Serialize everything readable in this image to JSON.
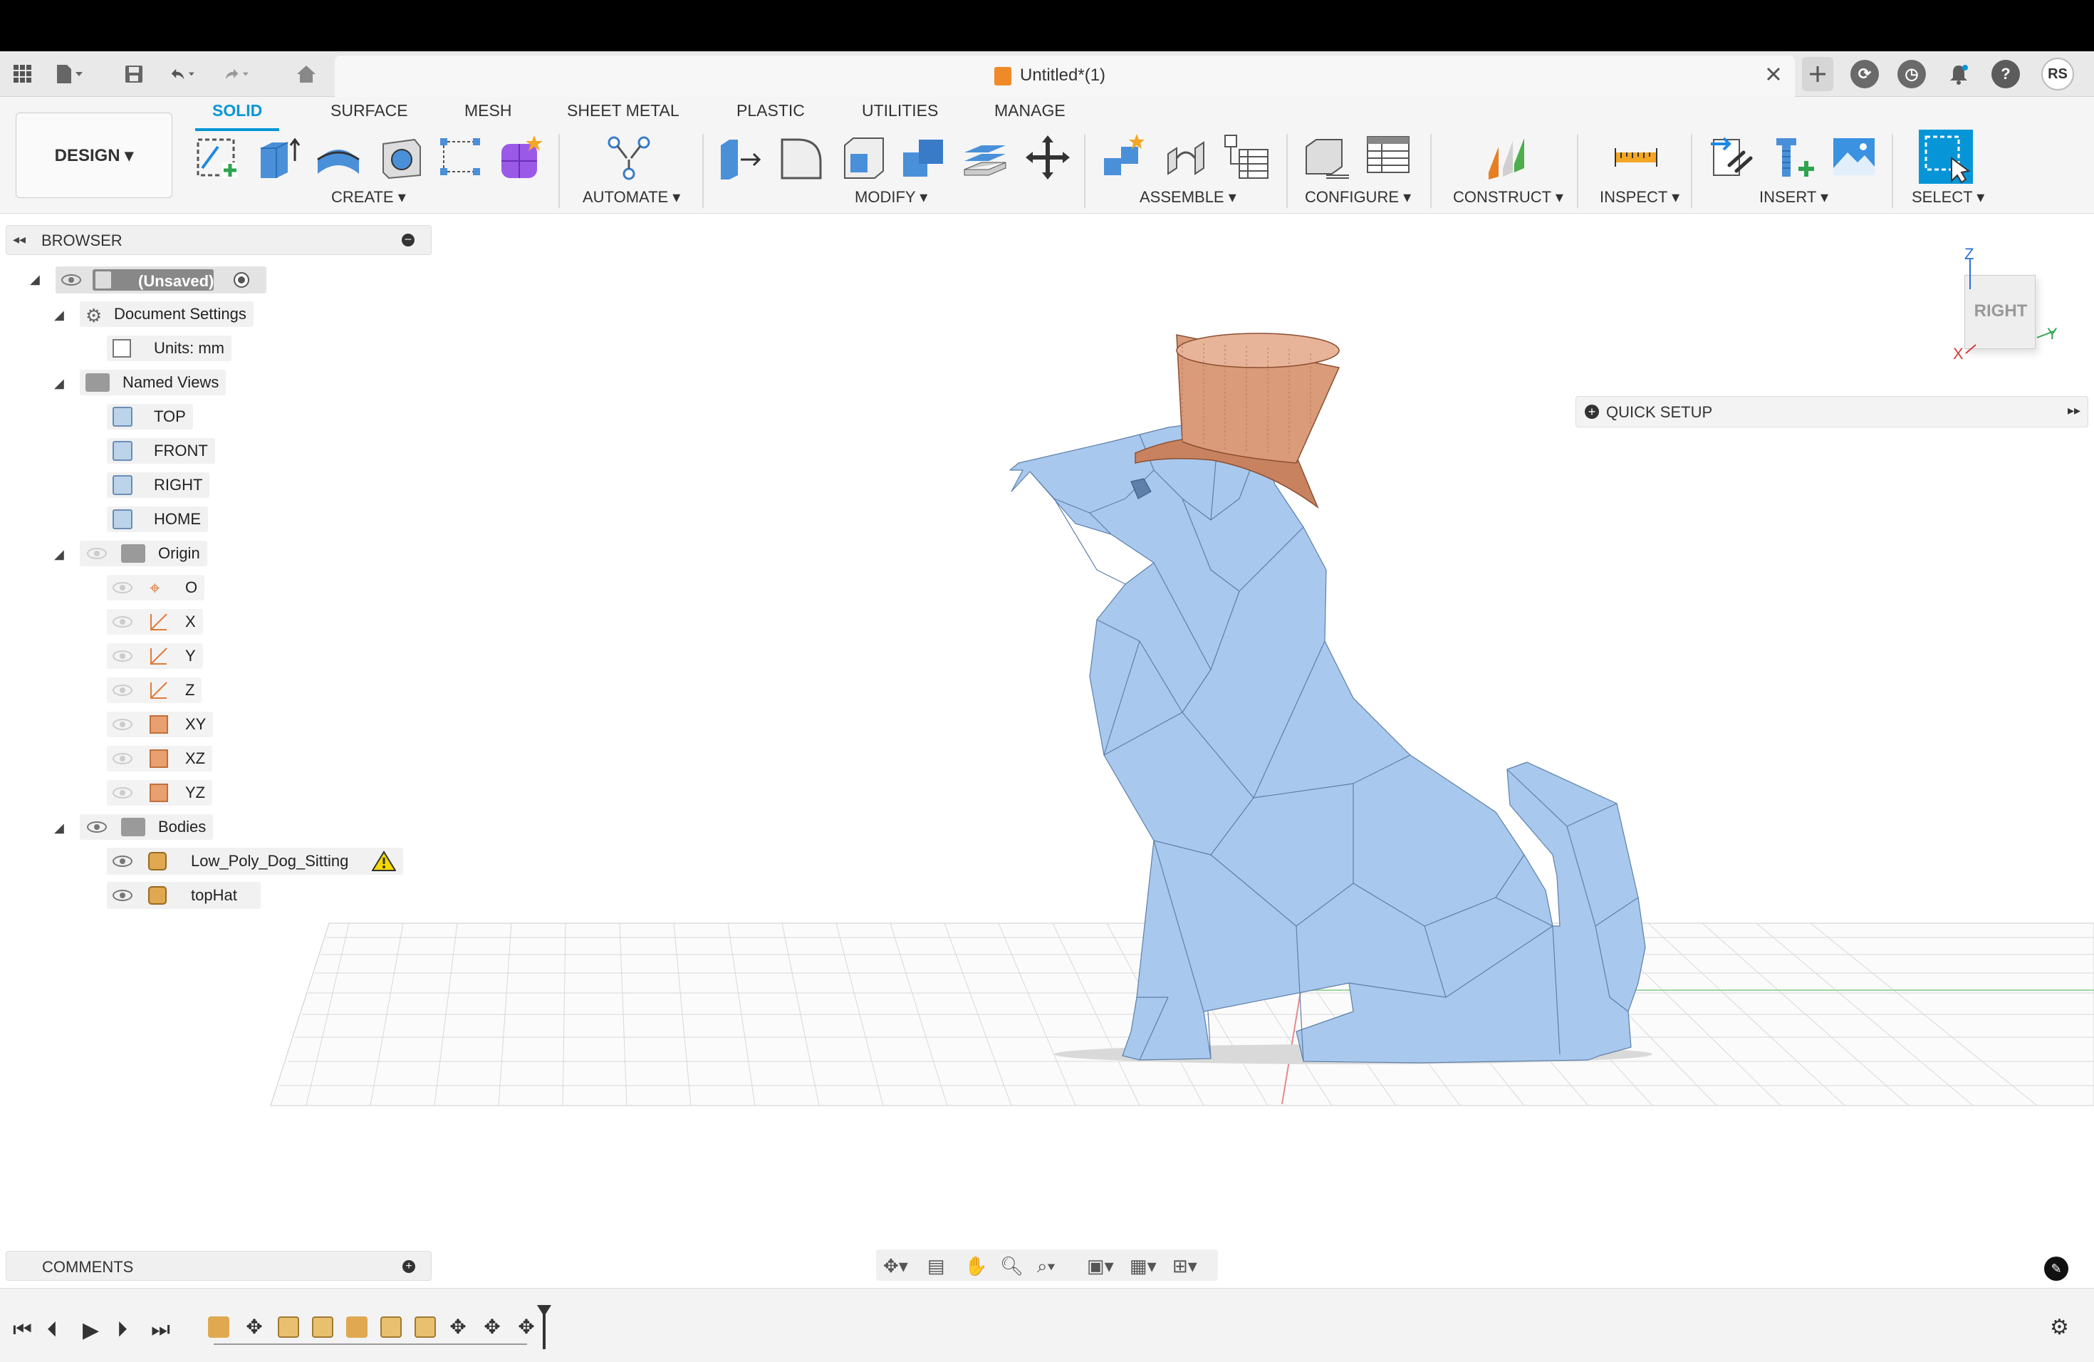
{
  "window": {
    "title": "Untitled*(1)"
  },
  "header_right": {
    "user_initials": "RS"
  },
  "workspace": {
    "design_label": "DESIGN ▾"
  },
  "tabs": [
    "SOLID",
    "SURFACE",
    "MESH",
    "SHEET METAL",
    "PLASTIC",
    "UTILITIES",
    "MANAGE"
  ],
  "groups": [
    "CREATE ▾",
    "AUTOMATE ▾",
    "MODIFY ▾",
    "ASSEMBLE ▾",
    "CONFIGURE ▾",
    "CONSTRUCT ▾",
    "INSPECT ▾",
    "INSERT ▾",
    "SELECT ▾"
  ],
  "browser": {
    "title": "BROWSER",
    "root": "(Unsaved)",
    "document_settings": "Document Settings",
    "units": "Units: mm",
    "named_views": "Named Views",
    "views": [
      "TOP",
      "FRONT",
      "RIGHT",
      "HOME"
    ],
    "origin": "Origin",
    "origin_items": [
      "O",
      "X",
      "Y",
      "Z",
      "XY",
      "XZ",
      "YZ"
    ],
    "bodies": "Bodies",
    "body_items": [
      "Low_Poly_Dog_Sitting",
      "topHat"
    ]
  },
  "quick_setup": {
    "label": "QUICK SETUP"
  },
  "viewcube": {
    "face": "RIGHT",
    "axis_z": "Z",
    "axis_y": "Y",
    "axis_x": "X"
  },
  "comments": {
    "label": "COMMENTS"
  },
  "colors": {
    "accent": "#0696d7",
    "model": "#a9c8ee",
    "hat": "#d99b7a"
  }
}
